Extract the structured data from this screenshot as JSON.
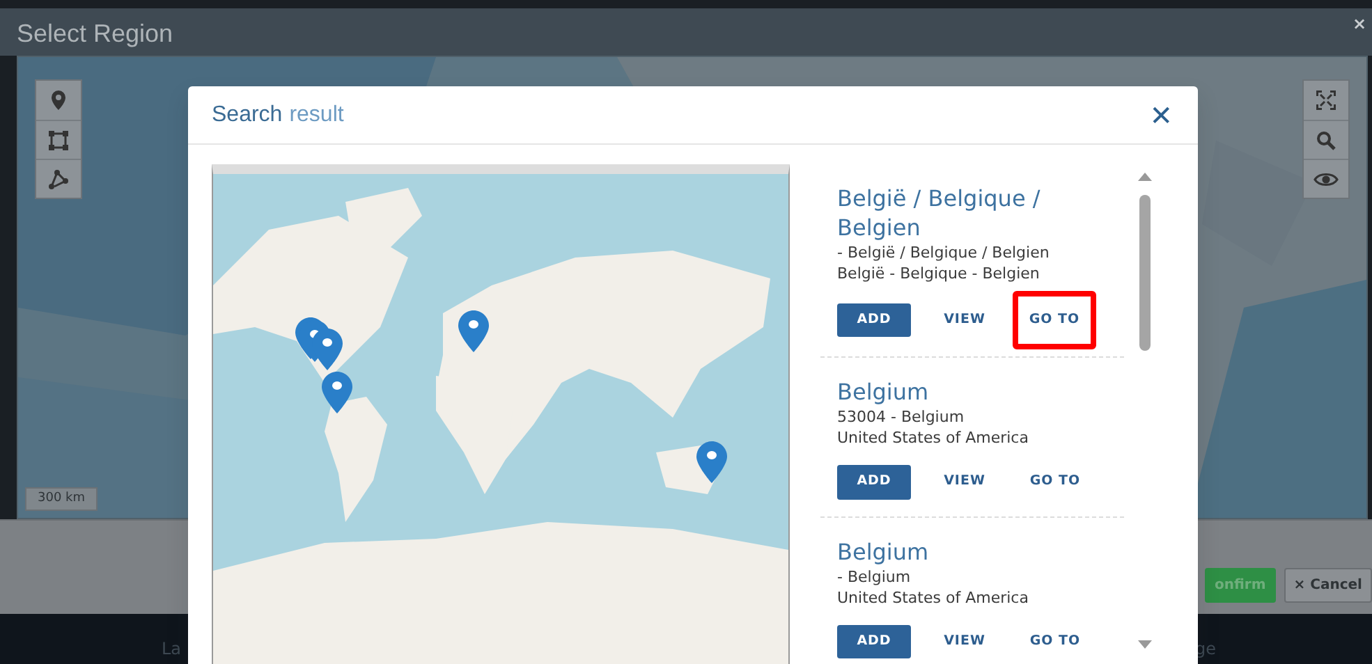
{
  "window": {
    "title": "Select Region",
    "close": "×"
  },
  "map": {
    "scale": "300 km"
  },
  "footer": {
    "buttons": [
      {
        "label": "onfirm",
        "kind": "success"
      },
      {
        "label": "× Cancel",
        "kind": "plain"
      }
    ]
  },
  "strip": [
    "La",
    "ge"
  ],
  "dialog": {
    "title": "Search",
    "title_accent": "result",
    "close": "✕",
    "results": [
      {
        "name": "België / Belgique / Belgien",
        "lines": [
          "- België / Belgique / Belgien",
          "België - Belgique - Belgien"
        ],
        "actions": [
          {
            "label": "ADD",
            "kind": "primary",
            "highlighted": false
          },
          {
            "label": "VIEW",
            "kind": "link",
            "highlighted": false
          },
          {
            "label": "GO TO",
            "kind": "link",
            "highlighted": true
          }
        ]
      },
      {
        "name": "Belgium",
        "lines": [
          "53004 - Belgium",
          "United States of America"
        ],
        "actions": [
          {
            "label": "ADD",
            "kind": "primary",
            "highlighted": false
          },
          {
            "label": "VIEW",
            "kind": "link",
            "highlighted": false
          },
          {
            "label": "GO TO",
            "kind": "link",
            "highlighted": false
          }
        ]
      },
      {
        "name": "Belgium",
        "lines": [
          "- Belgium",
          "United States of America"
        ],
        "actions": [
          {
            "label": "ADD",
            "kind": "primary",
            "highlighted": false
          },
          {
            "label": "VIEW",
            "kind": "link",
            "highlighted": false
          },
          {
            "label": "GO TO",
            "kind": "link",
            "highlighted": false
          }
        ]
      }
    ]
  }
}
